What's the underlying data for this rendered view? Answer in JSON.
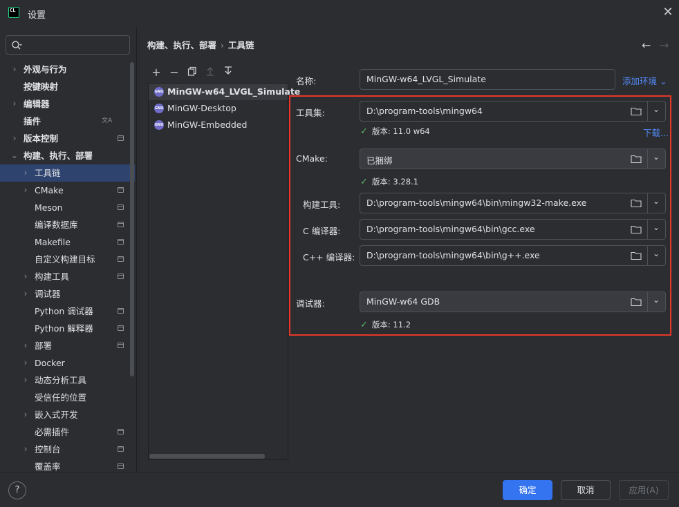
{
  "window": {
    "title": "设置",
    "logo_text": "CL"
  },
  "search": {
    "placeholder": ""
  },
  "sidebar": {
    "items": [
      {
        "label": "外观与行为",
        "level": 0,
        "expandable": true,
        "bold": true
      },
      {
        "label": "按键映射",
        "level": 0,
        "expandable": false,
        "bold": true
      },
      {
        "label": "编辑器",
        "level": 0,
        "expandable": true,
        "bold": true
      },
      {
        "label": "插件",
        "level": 0,
        "expandable": false,
        "bold": true,
        "translate_icon": true
      },
      {
        "label": "版本控制",
        "level": 0,
        "expandable": true,
        "bold": true,
        "project_icon": true
      },
      {
        "label": "构建、执行、部署",
        "level": 0,
        "expanded": true,
        "bold": true
      },
      {
        "label": "工具链",
        "level": 1,
        "expandable": true,
        "selected": true
      },
      {
        "label": "CMake",
        "level": 1,
        "expandable": true,
        "project_icon": true
      },
      {
        "label": "Meson",
        "level": 1,
        "expandable": false,
        "project_icon": true
      },
      {
        "label": "编译数据库",
        "level": 1,
        "expandable": false,
        "project_icon": true
      },
      {
        "label": "Makefile",
        "level": 1,
        "expandable": false,
        "project_icon": true
      },
      {
        "label": "自定义构建目标",
        "level": 1,
        "expandable": false,
        "project_icon": true
      },
      {
        "label": "构建工具",
        "level": 1,
        "expandable": true,
        "project_icon": true
      },
      {
        "label": "调试器",
        "level": 1,
        "expandable": true
      },
      {
        "label": "Python 调试器",
        "level": 1,
        "expandable": false,
        "project_icon": true
      },
      {
        "label": "Python 解释器",
        "level": 1,
        "expandable": false,
        "project_icon": true
      },
      {
        "label": "部署",
        "level": 1,
        "expandable": true,
        "project_icon": true
      },
      {
        "label": "Docker",
        "level": 1,
        "expandable": true
      },
      {
        "label": "动态分析工具",
        "level": 1,
        "expandable": true
      },
      {
        "label": "受信任的位置",
        "level": 1,
        "expandable": false
      },
      {
        "label": "嵌入式开发",
        "level": 1,
        "expandable": true
      },
      {
        "label": "必需插件",
        "level": 1,
        "expandable": false,
        "project_icon": true
      },
      {
        "label": "控制台",
        "level": 1,
        "expandable": true,
        "project_icon": true
      },
      {
        "label": "覆盖率",
        "level": 1,
        "expandable": false,
        "project_icon": true
      }
    ]
  },
  "breadcrumb": {
    "parent": "构建、执行、部署",
    "separator": "›",
    "current": "工具链"
  },
  "toolchains": {
    "items": [
      {
        "label": "MinGW-w64_LVGL_Simulate",
        "selected": true
      },
      {
        "label": "MinGW-Desktop",
        "selected": false
      },
      {
        "label": "MinGW-Embedded",
        "selected": false
      }
    ],
    "icon_text": "GNU"
  },
  "form": {
    "name_label": "名称:",
    "name_value": "MinGW-w64_LVGL_Simulate",
    "add_env_label": "添加环境",
    "toolset_label": "工具集:",
    "toolset_value": "D:\\program-tools\\mingw64",
    "toolset_version": "版本: 11.0 w64",
    "download_label": "下载...",
    "cmake_label": "CMake:",
    "cmake_value": "已捆绑",
    "cmake_version": "版本: 3.28.1",
    "build_tool_label": "构建工具:",
    "build_tool_value": "D:\\program-tools\\mingw64\\bin\\mingw32-make.exe",
    "c_compiler_label": "C 编译器:",
    "c_compiler_value": "D:\\program-tools\\mingw64\\bin\\gcc.exe",
    "cpp_compiler_label": "C++ 编译器:",
    "cpp_compiler_value": "D:\\program-tools\\mingw64\\bin\\g++.exe",
    "debugger_label": "调试器:",
    "debugger_value": "MinGW-w64 GDB",
    "debugger_version": "版本: 11.2"
  },
  "footer": {
    "help_label": "?",
    "ok_label": "确定",
    "cancel_label": "取消",
    "apply_label": "应用(A)"
  },
  "colors": {
    "accent": "#3574f0",
    "link": "#548af7",
    "highlight_box": "#e8372a",
    "check": "#5fb865",
    "selection": "#2e436e"
  }
}
